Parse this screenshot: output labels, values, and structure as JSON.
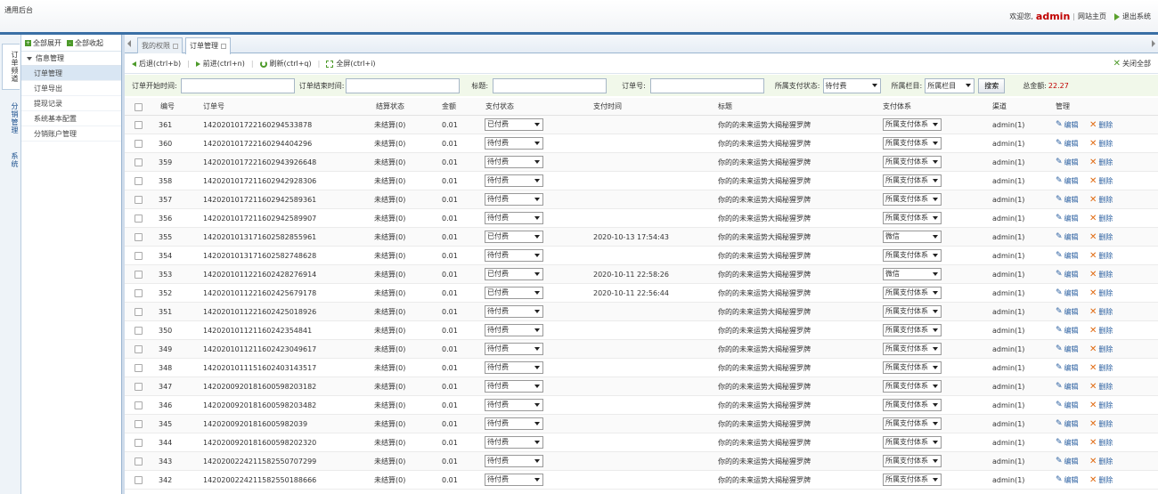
{
  "header": {
    "brand": "通用后台",
    "welcome": "欢迎您,",
    "user": "admin",
    "site_home": "网站主页",
    "logout": "退出系统"
  },
  "vtabs": [
    "订单频道",
    "分销管理",
    "系统"
  ],
  "sidebar": {
    "expand_all": "全部展开",
    "collapse_all": "全部收起",
    "group": "信息管理",
    "items": [
      "订单管理",
      "订单导出",
      "提现记录",
      "系统基本配置",
      "分销账户管理"
    ]
  },
  "tabs": [
    "我的权限",
    "订单管理"
  ],
  "toolbar": {
    "back": "后退(ctrl+b)",
    "forward": "前进(ctrl+n)",
    "refresh": "刷新(ctrl+q)",
    "fullscreen": "全屏(ctrl+i)",
    "close_all": "关闭全部"
  },
  "filter": {
    "start_label": "订单开始时间:",
    "end_label": "订单结束时间:",
    "title_label": "标题:",
    "order_no_label": "订单号:",
    "pay_status_label": "所属支付状态:",
    "pay_status_value": "待付费",
    "column_label": "所属栏目:",
    "column_value": "所属栏目",
    "search_btn": "搜索",
    "total_label": "总金额:",
    "total_value": "22.27"
  },
  "table": {
    "headers": [
      "编号",
      "订单号",
      "结算状态",
      "金额",
      "支付状态",
      "支付时间",
      "标题",
      "支付体系",
      "渠道",
      "管理"
    ],
    "edit_label": "编辑",
    "delete_label": "删除",
    "rows": [
      {
        "id": "361",
        "order": "142020101722160294533878",
        "settle": "未结算(0)",
        "amount": "0.01",
        "pay": "已付费",
        "time": "",
        "title": "你的的未来运势大揭秘猩罗牌",
        "system": "所属支付体系",
        "channel": "admin(1)"
      },
      {
        "id": "360",
        "order": "142020101722160294404296",
        "settle": "未结算(0)",
        "amount": "0.01",
        "pay": "待付费",
        "time": "",
        "title": "你的的未来运势大揭秘猩罗牌",
        "system": "所属支付体系",
        "channel": "admin(1)"
      },
      {
        "id": "359",
        "order": "142020101722160294392664​8",
        "settle": "未结算(0)",
        "amount": "0.01",
        "pay": "待付费",
        "time": "",
        "title": "你的的未来运势大揭秘猩罗牌",
        "system": "所属支付体系",
        "channel": "admin(1)"
      },
      {
        "id": "358",
        "order": "142020101721160294292830​6",
        "settle": "未结算(0)",
        "amount": "0.01",
        "pay": "待付费",
        "time": "",
        "title": "你的的未来运势大揭秘猩罗牌",
        "system": "所属支付体系",
        "channel": "admin(1)"
      },
      {
        "id": "357",
        "order": "142020101721160294258936​1",
        "settle": "未结算(0)",
        "amount": "0.01",
        "pay": "待付费",
        "time": "",
        "title": "你的的未来运势大揭秘猩罗牌",
        "system": "所属支付体系",
        "channel": "admin(1)"
      },
      {
        "id": "356",
        "order": "142020101721160294258990​7",
        "settle": "未结算(0)",
        "amount": "0.01",
        "pay": "待付费",
        "time": "",
        "title": "你的的未来运势大揭秘猩罗牌",
        "system": "所属支付体系",
        "channel": "admin(1)"
      },
      {
        "id": "355",
        "order": "142020101317160258285596​1",
        "settle": "未结算(0)",
        "amount": "0.01",
        "pay": "已付费",
        "time": "2020-10-13 17:54:43",
        "title": "你的的未来运势大揭秘猩罗牌",
        "system": "微信",
        "channel": "admin(1)"
      },
      {
        "id": "354",
        "order": "142020101317160258274862​8",
        "settle": "未结算(0)",
        "amount": "0.01",
        "pay": "待付费",
        "time": "",
        "title": "你的的未来运势大揭秘猩罗牌",
        "system": "所属支付体系",
        "channel": "admin(1)"
      },
      {
        "id": "353",
        "order": "142020101122160242827691​4",
        "settle": "未结算(0)",
        "amount": "0.01",
        "pay": "已付费",
        "time": "2020-10-11 22:58:26",
        "title": "你的的未来运势大揭秘猩罗牌",
        "system": "微信",
        "channel": "admin(1)"
      },
      {
        "id": "352",
        "order": "142020101122160242567917​8",
        "settle": "未结算(0)",
        "amount": "0.01",
        "pay": "已付费",
        "time": "2020-10-11 22:56:44",
        "title": "你的的未来运势大揭秘猩罗牌",
        "system": "所属支付体系",
        "channel": "admin(1)"
      },
      {
        "id": "351",
        "order": "142020101122160242501892​6",
        "settle": "未结算(0)",
        "amount": "0.01",
        "pay": "待付费",
        "time": "",
        "title": "你的的未来运势大揭秘猩罗牌",
        "system": "所属支付体系",
        "channel": "admin(1)"
      },
      {
        "id": "350",
        "order": "14202010112116024235484​1",
        "settle": "未结算(0)",
        "amount": "0.01",
        "pay": "待付费",
        "time": "",
        "title": "你的的未来运势大揭秘猩罗牌",
        "system": "所属支付体系",
        "channel": "admin(1)"
      },
      {
        "id": "349",
        "order": "142020101121160242304961​7",
        "settle": "未结算(0)",
        "amount": "0.01",
        "pay": "待付费",
        "time": "",
        "title": "你的的未来运势大揭秘猩罗牌",
        "system": "所属支付体系",
        "channel": "admin(1)"
      },
      {
        "id": "348",
        "order": "142020101115160240314351​7",
        "settle": "未结算(0)",
        "amount": "0.01",
        "pay": "待付费",
        "time": "",
        "title": "你的的未来运势大揭秘猩罗牌",
        "system": "所属支付体系",
        "channel": "admin(1)"
      },
      {
        "id": "347",
        "order": "142020092018160059820318​2",
        "settle": "未结算(0)",
        "amount": "0.01",
        "pay": "待付费",
        "time": "",
        "title": "你的的未来运势大揭秘猩罗牌",
        "system": "所属支付体系",
        "channel": "admin(1)"
      },
      {
        "id": "346",
        "order": "142020092018160059820348​2",
        "settle": "未结算(0)",
        "amount": "0.01",
        "pay": "待付费",
        "time": "",
        "title": "你的的未来运势大揭秘猩罗牌",
        "system": "所属支付体系",
        "channel": "admin(1)"
      },
      {
        "id": "345",
        "order": "14202009201816005982039",
        "settle": "未结算(0)",
        "amount": "0.01",
        "pay": "待付费",
        "time": "",
        "title": "你的的未来运势大揭秘猩罗牌",
        "system": "所属支付体系",
        "channel": "admin(1)"
      },
      {
        "id": "344",
        "order": "142020092018160059820232​0",
        "settle": "未结算(0)",
        "amount": "0.01",
        "pay": "待付费",
        "time": "",
        "title": "你的的未来运势大揭秘猩罗牌",
        "system": "所属支付体系",
        "channel": "admin(1)"
      },
      {
        "id": "343",
        "order": "142020022421158255070729​9",
        "settle": "未结算(0)",
        "amount": "0.01",
        "pay": "待付费",
        "time": "",
        "title": "你的的未来运势大揭秘猩罗牌",
        "system": "所属支付体系",
        "channel": "admin(1)"
      },
      {
        "id": "342",
        "order": "142020022421158255018866​6",
        "settle": "未结算(0)",
        "amount": "0.01",
        "pay": "待付费",
        "time": "",
        "title": "你的的未来运势大揭秘猩罗牌",
        "system": "所属支付体系",
        "channel": "admin(1)"
      }
    ]
  }
}
